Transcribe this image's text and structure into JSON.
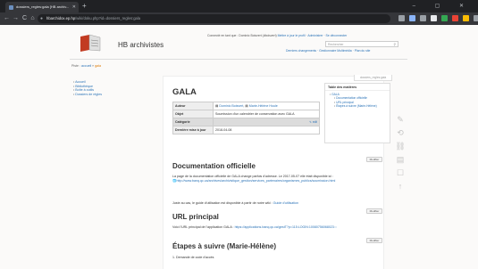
{
  "browser": {
    "tab_title": "dossiers_regles:gala [HB archiv...",
    "new_tab": "+",
    "window_controls": "‒ ▢ ✕",
    "url_host": "hbarchidox.ep.hp",
    "url_rest": "/wiki/doku.php?id=dossiers_regles:gala",
    "nav": {
      "back": "←",
      "forward": "→",
      "reload": "C",
      "home": "⌂"
    },
    "extension_colors": [
      "#9aa0a6",
      "#8ab4f8",
      "#9aa0a6",
      "#e8eaed",
      "#34a853",
      "#ea4335",
      "#fbbc04",
      "#9aa0a6"
    ]
  },
  "site": {
    "title": "HB archivistes",
    "user_line": "Connecté en tant que : Dominic Boisvert (dboisvert)",
    "user_links": [
      "Mettre à jour le profil",
      "Administrer",
      "Se déconnecter"
    ],
    "search_placeholder": "Rechercher",
    "tools": "Derniers changements · Gestionnaire Multimédia · Plan du site"
  },
  "breadcrumb": {
    "label": "Piste :",
    "items": [
      "accueil",
      "gala"
    ]
  },
  "sidebar": {
    "items": [
      "Accueil",
      "Bibliothèque",
      "Boîte à outils",
      "Dossiers de règles"
    ]
  },
  "page": {
    "id": "dossiers_regles:gala",
    "title": "GALA",
    "meta": {
      "author_label": "Auteur",
      "authors": [
        "Dominic Boisvert",
        "Marie-Hélène Houle"
      ],
      "object_label": "Objet",
      "object_value": "Soumission d'un calendrier de conservation avec GALA",
      "category_label": "Catégorie",
      "category_edit": "✎ edit",
      "updated_label": "Dernière mise à jour",
      "updated_value": "2018-04-08"
    },
    "toc": {
      "title": "Table des matières",
      "root": "GALA",
      "items": [
        "Documentation officielle",
        "URL principal",
        "Étapes à suivre (Marie-Hélène)"
      ]
    },
    "edit_label": "Modifier",
    "sections": [
      {
        "heading": "Documentation officielle",
        "paragraph": "La page de la documentation officielle de GALA change parfois d'adresse. Le 2017-05-07 elle était disponible ici :",
        "link": "http://www.banq.qc.ca/archives/archivistique_gestion/services_partenaires/organismes_publics/soumission.html",
        "note": "Juste au cas, le guide d'utilisation est disponible à partir de notre wiki :",
        "note_link": "Guide d'utilisation"
      },
      {
        "heading": "URL principal",
        "paragraph": "Voici l'URL principal de l'application GALA :",
        "link": "https://applications.banq.qc.ca/gestT?p=115:LOGIN:10080756068023:::"
      },
      {
        "heading": "Étapes à suivre (Marie-Hélène)",
        "paragraph": "1. Demande de code d'accès"
      }
    ]
  },
  "page_tools": {
    "edit": "✎",
    "history": "⟲",
    "backlinks": "⛓",
    "media": "▤",
    "subscribe": "☐",
    "top": "↑"
  }
}
